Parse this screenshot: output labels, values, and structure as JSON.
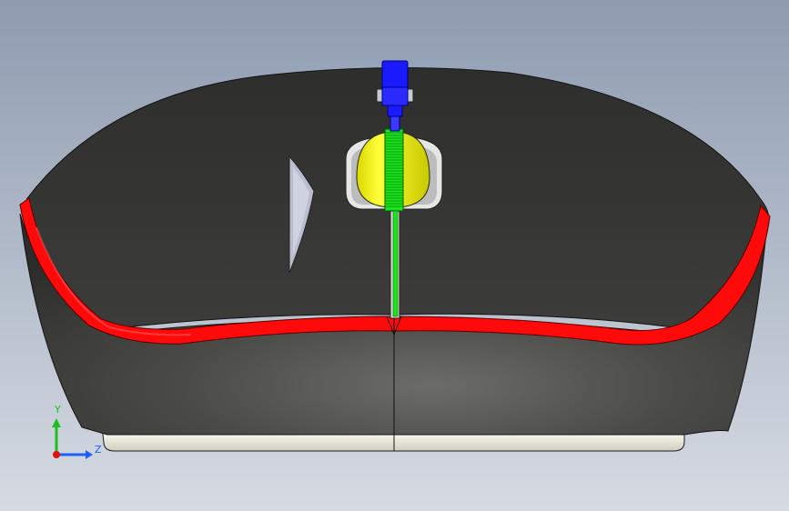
{
  "colors": {
    "background_top": "#8e9bb0",
    "background_bottom": "#d6dbe3",
    "shell": "#3a3a38",
    "shell_highlight": "#5a5a57",
    "accent_stripe": "#ff0a0a",
    "wheel": "#ffff1a",
    "wheel_shaft": "#19e619",
    "axle_part": "#1a1aff",
    "base_plate": "#e9e9d8",
    "side_cutout": "#b9bdd0",
    "axis_y": "#1fbf1f",
    "axis_z": "#1f5fff",
    "axis_origin": "#e01010"
  },
  "triad": {
    "y_label": "Y",
    "z_label": "Z"
  }
}
